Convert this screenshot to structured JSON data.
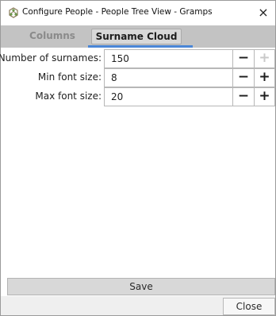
{
  "window": {
    "title": "Configure People - People Tree View - Gramps",
    "close_glyph": "×",
    "app_icon": "gramps-tree-icon"
  },
  "tabs": [
    {
      "label": "Columns",
      "active": false
    },
    {
      "label": "Surname Cloud",
      "active": true
    }
  ],
  "settings": [
    {
      "label": "Number of surnames:",
      "value": "150",
      "minus_enabled": true,
      "plus_enabled": false
    },
    {
      "label": "Min font size:",
      "value": "8",
      "minus_enabled": true,
      "plus_enabled": true
    },
    {
      "label": "Max font size:",
      "value": "20",
      "minus_enabled": true,
      "plus_enabled": true
    }
  ],
  "buttons": {
    "minus_glyph": "−",
    "plus_glyph": "+",
    "save_label": "Save",
    "close_label": "Close"
  },
  "colors": {
    "tab_bar": "#c3c3c3",
    "active_tab_underline": "#4a86d6"
  }
}
